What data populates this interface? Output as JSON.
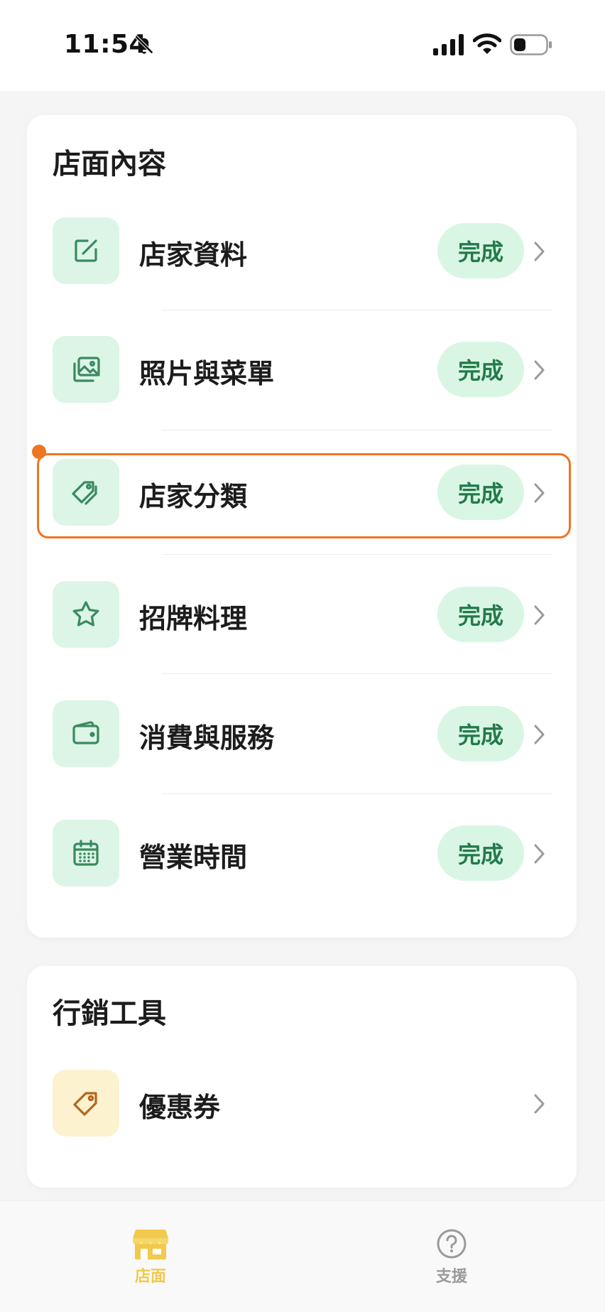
{
  "status_bar": {
    "time": "11:54",
    "icons": [
      "bell-off-icon",
      "signal-icon",
      "wifi-icon",
      "battery-icon"
    ]
  },
  "store_section": {
    "title": "店面內容",
    "items": [
      {
        "label": "店家資料",
        "status": "完成",
        "icon": "edit-icon"
      },
      {
        "label": "照片與菜單",
        "status": "完成",
        "icon": "image-icon"
      },
      {
        "label": "店家分類",
        "status": "完成",
        "icon": "tag-icon"
      },
      {
        "label": "招牌料理",
        "status": "完成",
        "icon": "star-icon"
      },
      {
        "label": "消費與服務",
        "status": "完成",
        "icon": "wallet-icon"
      },
      {
        "label": "營業時間",
        "status": "完成",
        "icon": "calendar-icon"
      }
    ]
  },
  "marketing_section": {
    "title": "行銷工具",
    "items": [
      {
        "label": "優惠券",
        "icon": "tag-icon"
      }
    ]
  },
  "tab_bar": {
    "tabs": [
      {
        "label": "店面",
        "icon": "store-icon",
        "active": true
      },
      {
        "label": "支援",
        "icon": "help-icon",
        "active": false
      }
    ]
  },
  "colors": {
    "accent_green": "#227a4a",
    "badge_bg": "#d9f6e4",
    "icon_bg_green": "#dcf5e6",
    "icon_bg_yellow": "#fdf2cf",
    "highlight_orange": "#ef7520",
    "active_tab_yellow": "#f2c94c"
  }
}
